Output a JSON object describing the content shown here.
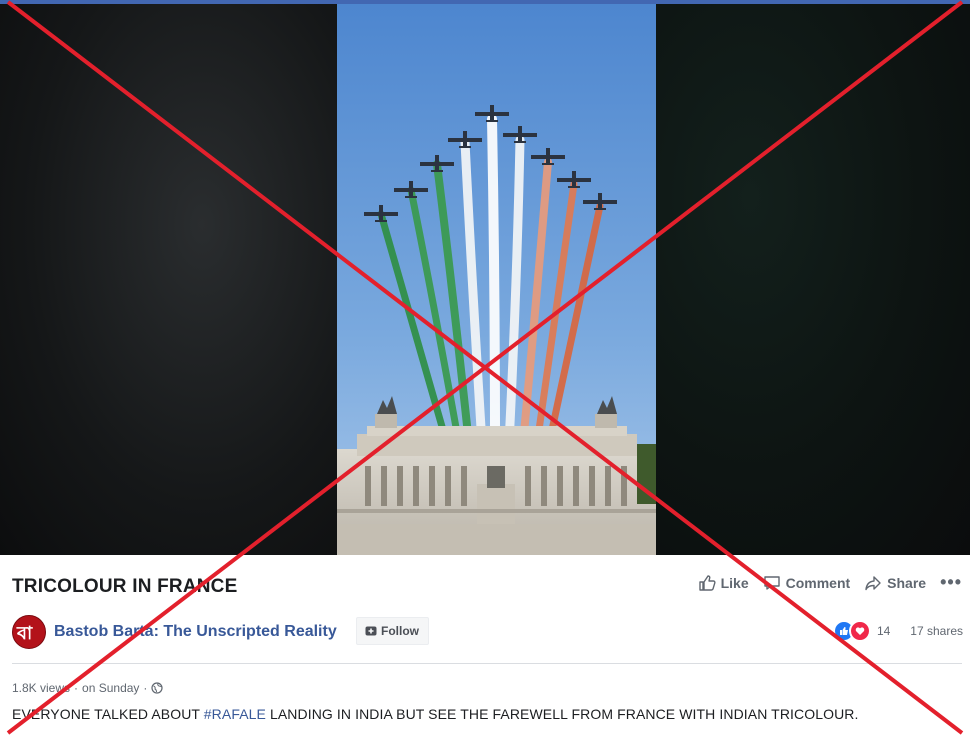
{
  "post": {
    "title": "TRICOLOUR IN FRANCE",
    "page_name": "Bastob Barta: The Unscripted Reality",
    "avatar_glyph": "বা",
    "follow_label": "Follow",
    "views": "1.8K views",
    "time": "on Sunday",
    "separator": "·",
    "caption_before": "EVERYONE TALKED ABOUT ",
    "caption_hashtag": "#RAFALE",
    "caption_after": " LANDING IN INDIA BUT SEE THE FAREWELL FROM FRANCE WITH INDIAN TRICOLOUR."
  },
  "actions": {
    "like_label": "Like",
    "comment_label": "Comment",
    "share_label": "Share",
    "more_label": "•••"
  },
  "reactions": {
    "count": "14",
    "shares": "17 shares",
    "types": [
      "like",
      "love"
    ]
  },
  "video": {
    "description_icon": "flyover-video-frame",
    "smoke_colors": [
      "#2f8f45",
      "#f4f6f7",
      "#e07a52"
    ]
  },
  "overlay": {
    "cross_color": "#e3202c"
  },
  "colors": {
    "accent": "#4267b2",
    "link": "#385898"
  }
}
